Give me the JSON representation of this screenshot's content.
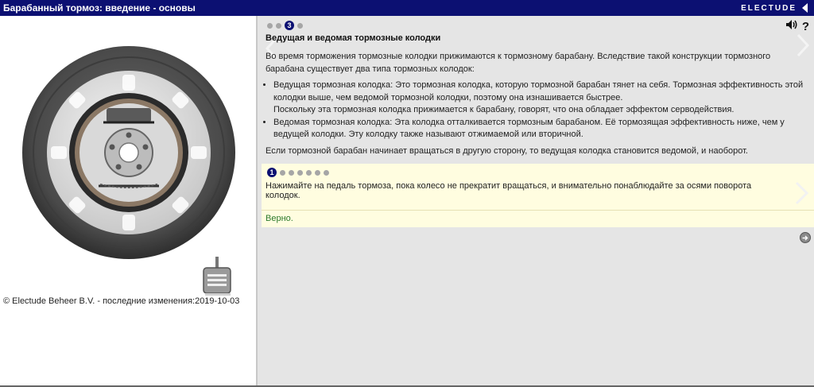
{
  "header": {
    "title": "Барабанный тормоз: введение - основы",
    "brand": "ELECTUDE",
    "collapse_icon": "triangle-left-icon"
  },
  "left_panel": {
    "copyright": "© Electude Beheer B.V. - последние изменения:2019-10-03",
    "pedal_icon": "brake-pedal-icon"
  },
  "content": {
    "page_indicator": {
      "total": 4,
      "current": 3,
      "current_label": "3"
    },
    "heading": "Ведущая и ведомая тормозные колодки",
    "intro": "Во время торможения тормозные колодки прижимаются к тормозному барабану. Вследствие такой конструкции тормозного барабана существует два типа тормозных колодок:",
    "bullets": [
      {
        "line1": "Ведущая тормозная колодка: Это тормозная колодка, которую тормозной барабан тянет на себя. Тормозная эффективность этой колодки выше, чем ведомой тормозной колодки, поэтому она изнашивается быстрее.",
        "line2": "Поскольку эта тормозная колодка прижимается к барабану, говорят, что она обладает эффектом серводействия."
      },
      {
        "line1": "Ведомая тормозная колодка: Эта колодка отталкивается тормозным барабаном. Её тормозящая эффективность ниже, чем у ведущей колодки. Эту колодку также называют отжимаемой или вторичной.",
        "line2": ""
      }
    ],
    "footer": "Если тормозной барабан начинает вращаться в другую сторону, то ведущая колодка становится ведомой, и наоборот."
  },
  "task": {
    "step_indicator": {
      "total": 7,
      "current": 1,
      "current_label": "1"
    },
    "instruction": "Нажимайте на педаль тормоза, пока колесо не прекратит вращаться, и внимательно понаблюдайте за осями поворота колодок.",
    "feedback": "Верно."
  },
  "icons": {
    "speaker": "speaker-icon",
    "help": "?",
    "prev": "chevron-left-icon",
    "next": "chevron-right-icon",
    "side": "circle-arrow-icon"
  },
  "colors": {
    "header_bg": "#0c1072",
    "content_bg": "#e5e5e5",
    "task_bg": "#fffde0",
    "feedback": "#2c7a2c"
  }
}
